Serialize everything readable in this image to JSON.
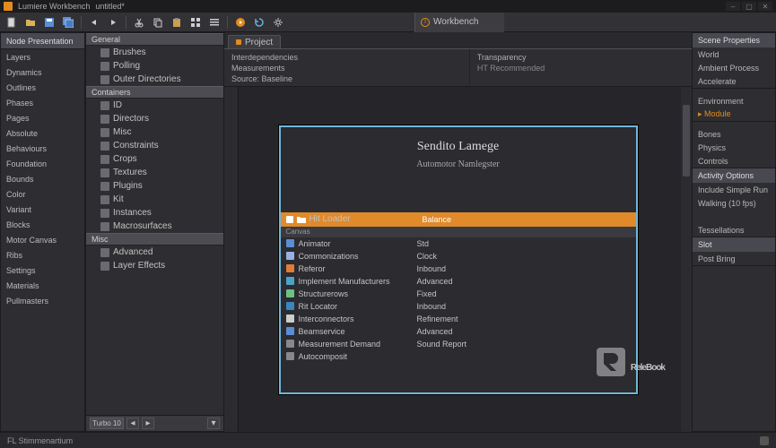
{
  "title_bar": {
    "app_title": "Lumiere Workbench",
    "doc_title": "untitled*"
  },
  "mode_tab": "Workbench",
  "left_panel": {
    "header": "Node Presentation",
    "items": [
      "Layers",
      "Dynamics",
      "Outlines",
      "Phases",
      "Pages",
      "Absolute",
      "Behaviours",
      "Foundation",
      "Bounds",
      "Color",
      "Variant",
      "Blocks",
      "Motor Canvas",
      "Ribs",
      "Settings",
      "Materials",
      "Pullmasters"
    ]
  },
  "mid_panel": {
    "group1_hdr": "General",
    "group1_items": [
      "Brushes",
      "Polling",
      "Outer Directories"
    ],
    "group2_hdr": "Containers",
    "group2_items": [
      "ID",
      "Directors",
      "Misc",
      "Constraints",
      "Crops",
      "Textures",
      "Plugins",
      "Kit",
      "Instances",
      "Macrosurfaces"
    ],
    "group3_hdr": "Misc",
    "group3_items": [
      "Advanced",
      "Layer Effects"
    ],
    "foot_btn": "Turbo 10"
  },
  "center": {
    "tab": "Project",
    "info_left": [
      "Interdependencies",
      "Measurements",
      "Source: Baseline"
    ],
    "info_right_label": "Transparency",
    "info_right_value": "HT Recommended",
    "stage_title": "Sendito Lamege",
    "stage_sub": "Automotor Namlegster",
    "hl_left": "Hit Loader",
    "hl_right": "Balance",
    "sub_hdr": "Canvas",
    "rows": [
      {
        "name": "Animator",
        "val": "Std",
        "color": "#5b8dd6"
      },
      {
        "name": "Commonizations",
        "val": "Clock",
        "color": "#97b2e0"
      },
      {
        "name": "Referor",
        "val": "Inbound",
        "color": "#e07b3a"
      },
      {
        "name": "Implement Manufacturers",
        "val": "Advanced",
        "color": "#4aa3c7"
      },
      {
        "name": "Structurerows",
        "val": "Fixed",
        "color": "#6cc184"
      },
      {
        "name": "Rit Locator",
        "val": "Inbound",
        "color": "#3a86c2"
      },
      {
        "name": "Interconnectors",
        "val": "Refinement",
        "color": "#cccccc"
      },
      {
        "name": "Beamservice",
        "val": "Advanced",
        "color": "#5b8dd6"
      },
      {
        "name": "Measurement Demand",
        "val": "Sound Report",
        "color": "#888"
      },
      {
        "name": "Autocomposit",
        "val": "",
        "color": "#888"
      }
    ]
  },
  "right_panel": {
    "hdr1": "Scene Properties",
    "items1": [
      "World",
      "Ambient Process",
      "Accelerate"
    ],
    "items2": [
      "Environment",
      "Module"
    ],
    "items3": [
      "Bones",
      "Physics",
      "Controls"
    ],
    "hdr2": "Activity Options",
    "items4": [
      "Include Simple Run",
      "Walking (10 fps)",
      "",
      "Tessellations"
    ],
    "hdr3": "Slot",
    "items5": [
      "Post Bring"
    ]
  },
  "statusbar": {
    "left": "FL Stimmenartium"
  },
  "watermark_text": "ReleBook"
}
